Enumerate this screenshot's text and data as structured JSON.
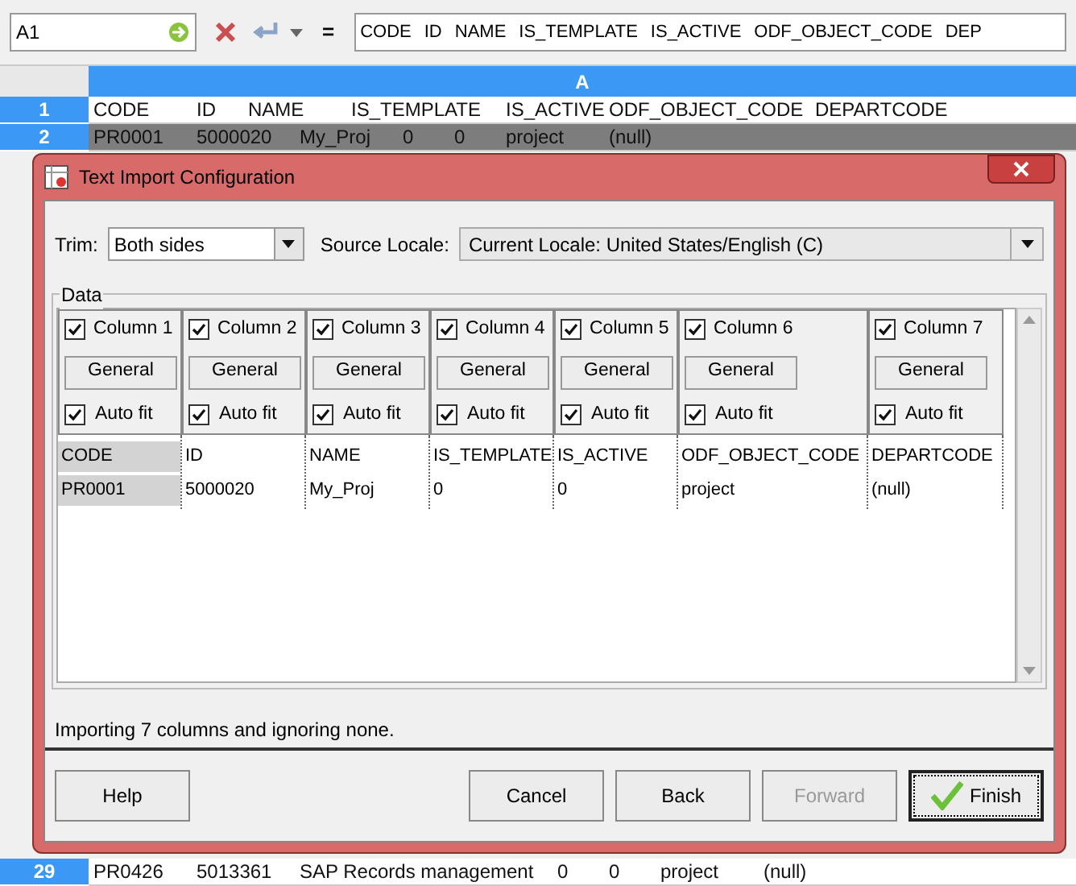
{
  "toolbar": {
    "name_box": "A1",
    "equals": "=",
    "formula": [
      "CODE",
      "ID",
      "NAME",
      "IS_TEMPLATE",
      "IS_ACTIVE",
      "ODF_OBJECT_CODE",
      "DEP"
    ]
  },
  "sheet": {
    "column_header": "A",
    "rows": [
      {
        "number": "1",
        "selected": false,
        "cell_text": "CODE\tID\tNAME\tIS_TEMPLATE\tIS_ACTIVE\tODF_OBJECT_CODE\tDEPARTCODE"
      },
      {
        "number": "2",
        "selected": true,
        "cell_text": "PR0001\t5000020\tMy_Proj\t0\t0\tproject\t(null)"
      }
    ],
    "bottom_row": {
      "number": "29",
      "selected": false,
      "cell_text": "PR0426\t5013361\tSAP Records management\t0\t0\tproject\t(null)"
    }
  },
  "dialog": {
    "title": "Text Import Configuration",
    "trim": {
      "label": "Trim:",
      "value": "Both sides"
    },
    "locale": {
      "label": "Source Locale:",
      "value": "Current Locale: United States/English (C)"
    },
    "data_group": "Data",
    "columns": [
      {
        "label": "Column 1",
        "checked": true,
        "format": "General",
        "autofit_label": "Auto fit",
        "autofit": true,
        "selected": true,
        "cells": [
          "CODE",
          "PR0001"
        ]
      },
      {
        "label": "Column 2",
        "checked": true,
        "format": "General",
        "autofit_label": "Auto fit",
        "autofit": true,
        "selected": false,
        "cells": [
          "ID",
          "5000020"
        ]
      },
      {
        "label": "Column 3",
        "checked": true,
        "format": "General",
        "autofit_label": "Auto fit",
        "autofit": true,
        "selected": false,
        "cells": [
          "NAME",
          "My_Proj"
        ]
      },
      {
        "label": "Column 4",
        "checked": true,
        "format": "General",
        "autofit_label": "Auto fit",
        "autofit": true,
        "selected": false,
        "cells": [
          "IS_TEMPLATE",
          "0"
        ]
      },
      {
        "label": "Column 5",
        "checked": true,
        "format": "General",
        "autofit_label": "Auto fit",
        "autofit": true,
        "selected": false,
        "cells": [
          "IS_ACTIVE",
          "0"
        ]
      },
      {
        "label": "Column 6",
        "checked": true,
        "format": "General",
        "autofit_label": "Auto fit",
        "autofit": true,
        "selected": false,
        "cells": [
          "ODF_OBJECT_CODE",
          "project"
        ]
      },
      {
        "label": "Column 7",
        "checked": true,
        "format": "General",
        "autofit_label": "Auto fit",
        "autofit": true,
        "selected": false,
        "cells": [
          "DEPARTCODE",
          "(null)"
        ]
      }
    ],
    "status": "Importing 7 columns and ignoring none.",
    "buttons": [
      {
        "label": "Help",
        "disabled": false,
        "default": false,
        "kind": "left"
      },
      {
        "label": "Cancel",
        "disabled": false,
        "default": false,
        "kind": "right"
      },
      {
        "label": "Back",
        "disabled": false,
        "default": false,
        "kind": "right"
      },
      {
        "label": "Forward",
        "disabled": true,
        "default": false,
        "kind": "right"
      },
      {
        "label": "Finish",
        "disabled": false,
        "default": true,
        "kind": "right"
      }
    ]
  }
}
